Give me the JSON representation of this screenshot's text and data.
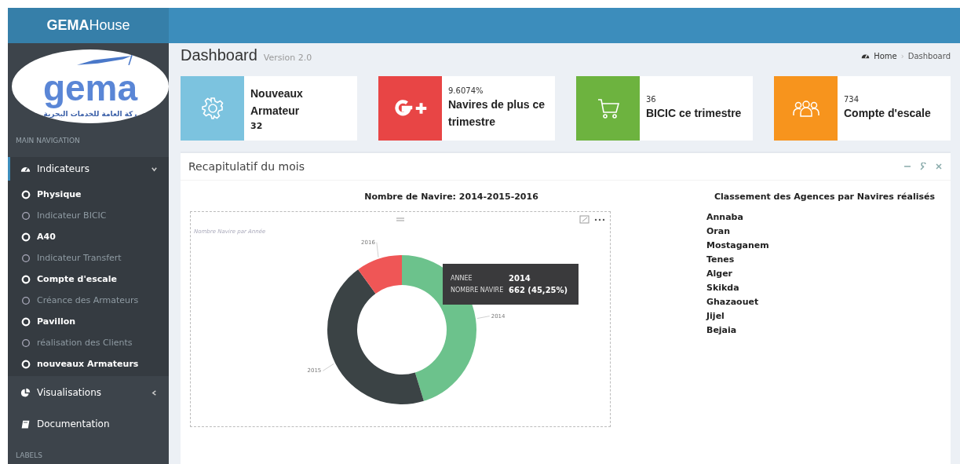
{
  "brand": {
    "bold": "GEMA",
    "rest": "House"
  },
  "logo": {
    "name": "gema",
    "tagline": "ركة العامة للخدمات البحرية"
  },
  "sidebar": {
    "header": "MAIN NAVIGATION",
    "items": [
      {
        "label": "Indicateurs",
        "expanded": true,
        "selected": true,
        "children": [
          {
            "label": "Physique",
            "emphasized": true
          },
          {
            "label": "Indicateur BICIC",
            "emphasized": false
          },
          {
            "label": "A40",
            "emphasized": true
          },
          {
            "label": "Indicateur Transfert",
            "emphasized": false
          },
          {
            "label": "Compte d'escale",
            "emphasized": true
          },
          {
            "label": "Créance des Armateurs",
            "emphasized": false
          },
          {
            "label": "Pavillon",
            "emphasized": true
          },
          {
            "label": "réalisation des Clients",
            "emphasized": false
          },
          {
            "label": "nouveaux Armateurs",
            "emphasized": true
          }
        ]
      },
      {
        "label": "Visualisations",
        "expanded": false,
        "selected": false
      },
      {
        "label": "Documentation",
        "selected": false
      }
    ],
    "footer": "LABELS"
  },
  "page": {
    "title": "Dashboard",
    "version": "Version 2.0",
    "breadcrumb": [
      "Home",
      "Dashboard"
    ],
    "breadcrumb_separator": "›"
  },
  "info_boxes": [
    {
      "color": "#7cc3df",
      "text": "Nouveaux Armateur",
      "value": "32"
    },
    {
      "color": "#e84545",
      "number": "9.6074%",
      "text": "Navires de plus ce trimestre"
    },
    {
      "color": "#6db33f",
      "number": "36",
      "text": "BICIC ce trimestre"
    },
    {
      "color": "#f7941d",
      "number": "734",
      "text": "Compte d'escale"
    }
  ],
  "panel": {
    "title": "Recapitulatif du mois",
    "chart": {
      "title": "Nombre de Navire: 2014-2015-2016",
      "subtitle": "Nombre Navire par Année",
      "chart_data": {
        "type": "donut",
        "categories": [
          "2014",
          "2015",
          "2016"
        ],
        "values": [
          45.25,
          44.75,
          10
        ]
      },
      "slices": [
        {
          "color": "#6cc28c"
        },
        {
          "color": "#3b4345"
        },
        {
          "color": "#ef5656"
        }
      ],
      "tooltip": {
        "rows": [
          {
            "label": "ANNEE",
            "value": "2014"
          },
          {
            "label": "NOMBRE NAVIRE",
            "value": "662 (45,25%)"
          }
        ]
      }
    },
    "ranking": {
      "title": "Classement des Agences par Navires réalisés",
      "items": [
        "Annaba",
        "Oran",
        "Mostaganem",
        "Tenes",
        "Alger",
        "Skikda",
        "Ghazaouet",
        "Jijel",
        "Bejaia"
      ]
    }
  }
}
